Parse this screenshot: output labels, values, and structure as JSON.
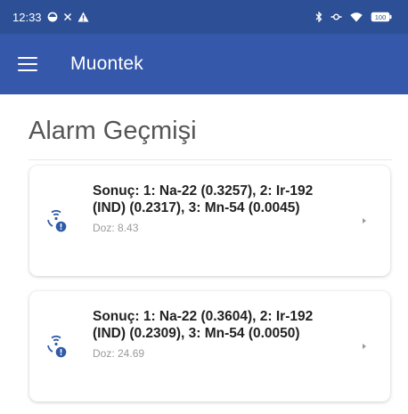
{
  "status_bar": {
    "time": "12:33",
    "icons": [
      "sync-circle-icon",
      "close-icon",
      "warning-icon",
      "bluetooth-icon",
      "vpn-key-icon",
      "wifi-icon",
      "battery-icon"
    ],
    "battery_text": "100"
  },
  "app_bar": {
    "menu_icon": "hamburger-menu-icon",
    "title": "Muontek"
  },
  "page": {
    "title": "Alarm Geçmişi"
  },
  "alarms": [
    {
      "icon": "radiation-alert-icon",
      "result": "Sonuç: 1: Na-22 (0.3257), 2: Ir-192 (IND) (0.2317), 3: Mn-54 (0.0045)",
      "dose": "Doz: 8.43"
    },
    {
      "icon": "radiation-alert-icon",
      "result": "Sonuç: 1: Na-22 (0.3604), 2: Ir-192 (IND) (0.2309), 3: Mn-54 (0.0050)",
      "dose": "Doz: 24.69"
    }
  ],
  "colors": {
    "status_bar": "#2c4f95",
    "app_bar": "#3558ab",
    "icon_accent": "#2f5aa8"
  }
}
